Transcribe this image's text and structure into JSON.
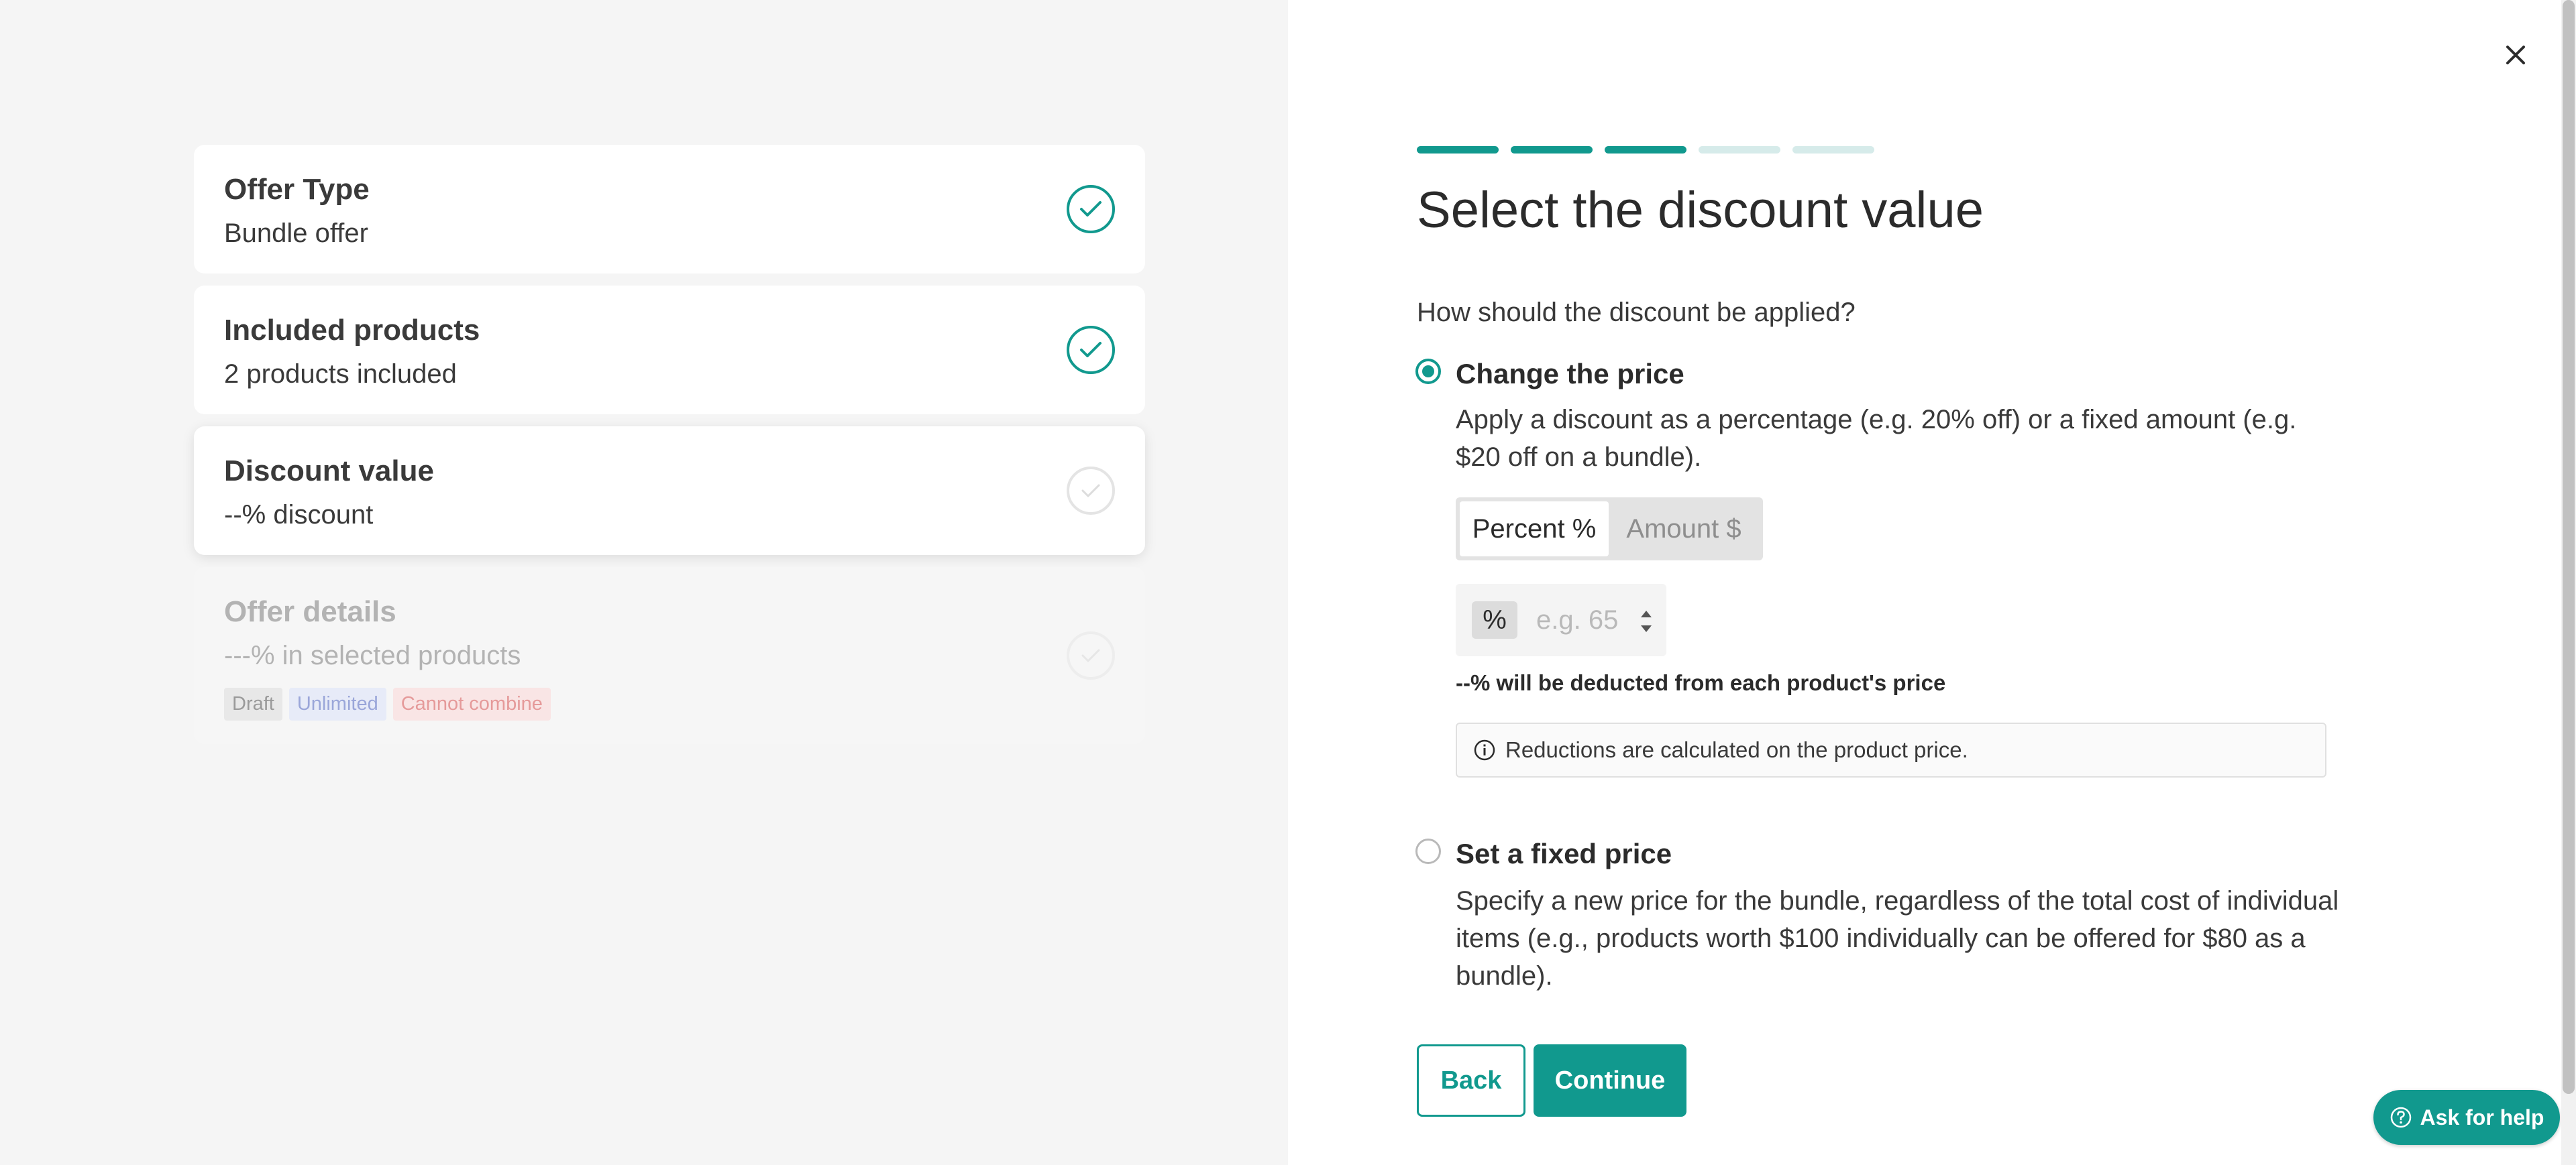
{
  "steps": [
    {
      "title": "Offer Type",
      "subtitle": "Bundle offer",
      "status": "complete"
    },
    {
      "title": "Included products",
      "subtitle": "2 products included",
      "status": "complete"
    },
    {
      "title": "Discount value",
      "subtitle": "--% discount",
      "status": "current"
    },
    {
      "title": "Offer details",
      "subtitle": "---% in selected products",
      "status": "upcoming"
    }
  ],
  "tags": {
    "draft": "Draft",
    "unlimited": "Unlimited",
    "cannot_combine": "Cannot combine"
  },
  "progress": {
    "completed": 3,
    "total": 5
  },
  "heading": "Select the discount value",
  "question": "How should the discount be applied?",
  "option_change": {
    "label": "Change the price",
    "description": "Apply a discount as a percentage (e.g. 20% off) or a fixed amount (e.g. $20 off on a bundle).",
    "selected": true
  },
  "toggle": {
    "percent": "Percent %",
    "amount": "Amount $",
    "active": "percent"
  },
  "discount_input": {
    "prefix": "%",
    "placeholder": "e.g. 65",
    "value": ""
  },
  "hint": "--% will be deducted from each product's price",
  "info": "Reductions are calculated on the product price.",
  "option_fixed": {
    "label": "Set a fixed price",
    "description": "Specify a new price for the bundle, regardless of the total cost of individual items (e.g., products worth $100 individually can be offered for $80 as a bundle).",
    "selected": false
  },
  "buttons": {
    "back": "Back",
    "continue": "Continue"
  },
  "help": "Ask for help",
  "colors": {
    "accent": "#11998e",
    "accent_light": "#d6ebea"
  }
}
